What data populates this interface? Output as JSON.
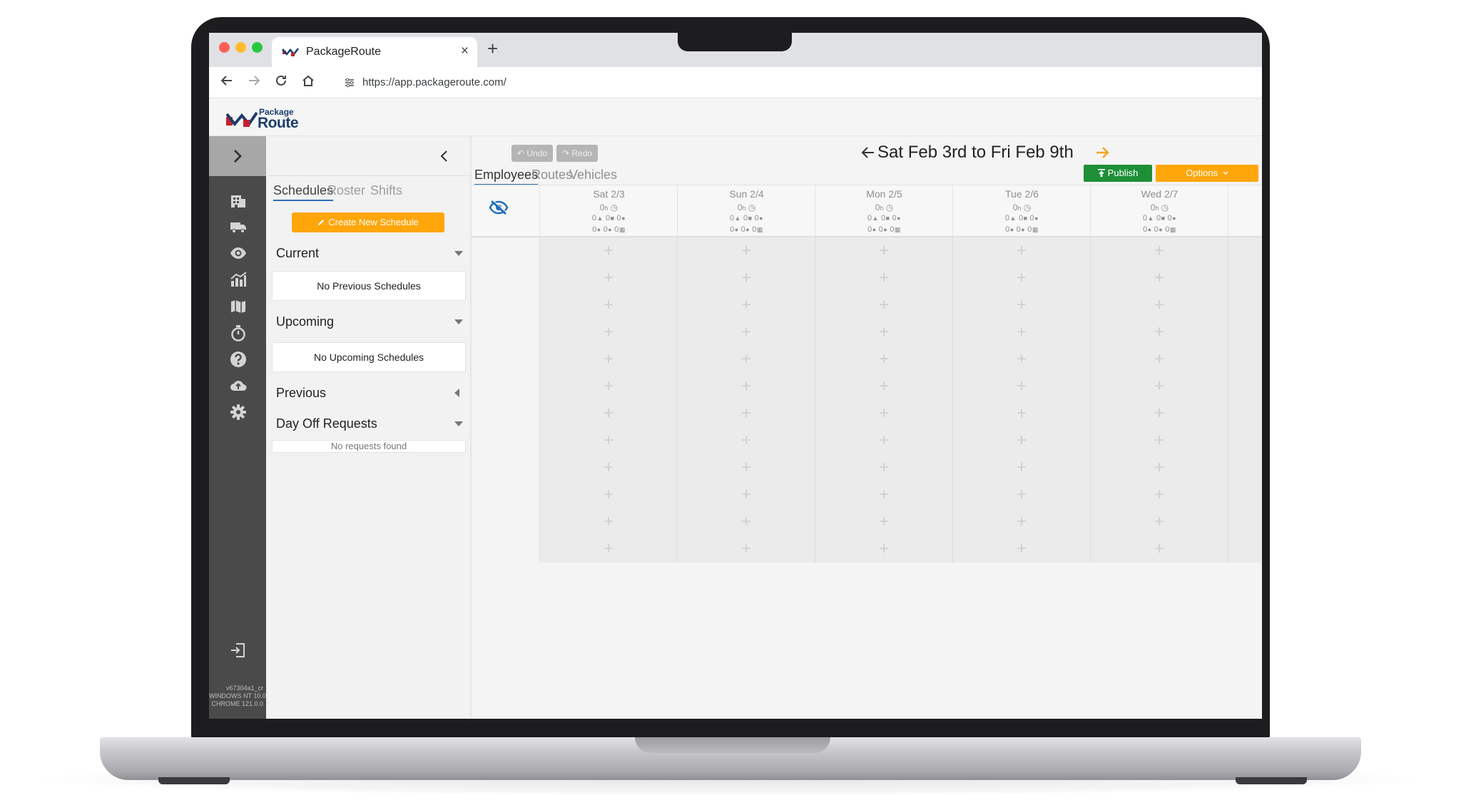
{
  "browser": {
    "tab_title": "PackageRoute",
    "url": "https://app.packageroute.com/",
    "new_tab_symbol": "+",
    "close_symbol": "×"
  },
  "app": {
    "logo_top": "Package",
    "logo_bottom": "Route",
    "build_info": [
      "v67304a1_cr",
      "WINDOWS NT 10.0",
      "CHROME 121.0.0"
    ]
  },
  "sidebar": {
    "icons": [
      "building-icon",
      "truck-icon",
      "eye-icon",
      "chart-icon",
      "map-icon",
      "stopwatch-icon",
      "help-icon",
      "cloud-upload-icon",
      "gear-icon"
    ]
  },
  "panel": {
    "tabs": [
      "Schedules",
      "Roster",
      "Shifts"
    ],
    "create_button": "Create New Schedule",
    "sections": {
      "current": {
        "title": "Current",
        "empty": "No Previous Schedules"
      },
      "upcoming": {
        "title": "Upcoming",
        "empty": "No Upcoming Schedules"
      },
      "previous": {
        "title": "Previous"
      },
      "day_off": {
        "title": "Day Off Requests",
        "empty": "No requests found"
      }
    }
  },
  "main": {
    "undo_label": "Undo",
    "redo_label": "Redo",
    "date_range": "Sat Feb 3rd to Fri Feb 9th",
    "tabs": [
      "Employees",
      "Routes",
      "Vehicles"
    ],
    "publish_label": "Publish",
    "options_label": "Options",
    "days": [
      {
        "name": "Sat 2/3",
        "hours": "0",
        "stats1": [
          "0",
          "0",
          "0"
        ],
        "stats2": [
          "0",
          "0",
          "0"
        ]
      },
      {
        "name": "Sun 2/4",
        "hours": "0",
        "stats1": [
          "0",
          "0",
          "0"
        ],
        "stats2": [
          "0",
          "0",
          "0"
        ]
      },
      {
        "name": "Mon 2/5",
        "hours": "0",
        "stats1": [
          "0",
          "0",
          "0"
        ],
        "stats2": [
          "0",
          "0",
          "0"
        ]
      },
      {
        "name": "Tue 2/6",
        "hours": "0",
        "stats1": [
          "0",
          "0",
          "0"
        ],
        "stats2": [
          "0",
          "0",
          "0"
        ]
      },
      {
        "name": "Wed 2/7",
        "hours": "0",
        "stats1": [
          "0",
          "0",
          "0"
        ],
        "stats2": [
          "0",
          "0",
          "0"
        ]
      }
    ],
    "hours_unit": "h",
    "row_count": 12,
    "add_symbol": "+"
  },
  "colors": {
    "accent_orange": "#ffa60a",
    "publish_green": "#1e8f37",
    "sidebar_dark": "#4a4a4a",
    "tab_underline": "#2f6db5",
    "logo_red": "#c4202f",
    "logo_navy": "#1c3d6b"
  }
}
